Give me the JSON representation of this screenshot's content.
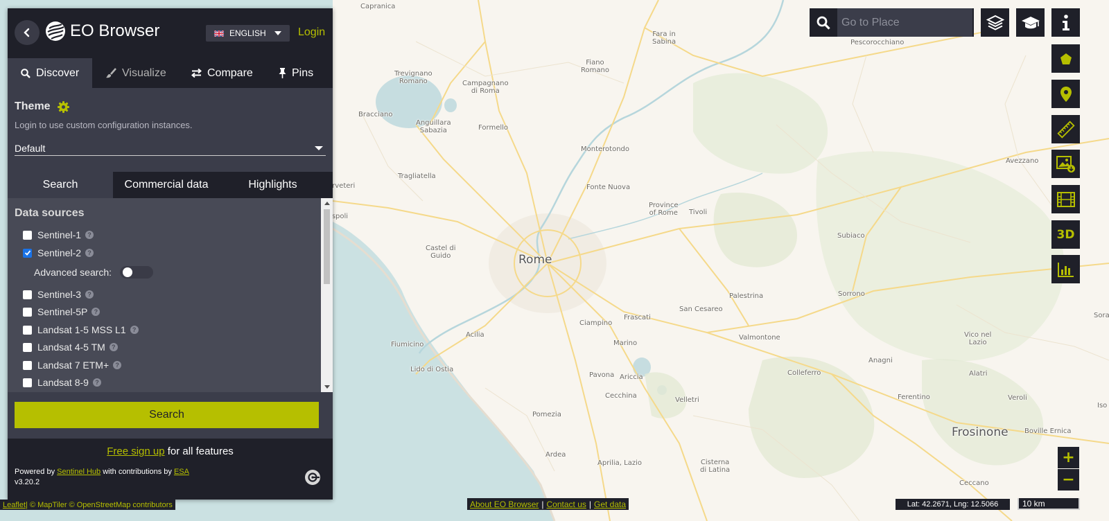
{
  "sidebar": {
    "brand": "EO Browser",
    "language": "ENGLISH",
    "login": "Login",
    "tabs": [
      {
        "label": "Discover"
      },
      {
        "label": "Visualize"
      },
      {
        "label": "Compare"
      },
      {
        "label": "Pins"
      }
    ],
    "theme": {
      "title": "Theme",
      "note": "Login to use custom configuration instances.",
      "selected": "Default"
    },
    "subtabs": [
      {
        "label": "Search"
      },
      {
        "label": "Commercial data"
      },
      {
        "label": "Highlights"
      }
    ],
    "data_sources": {
      "title": "Data sources",
      "items": [
        {
          "label": "Sentinel-1",
          "checked": false
        },
        {
          "label": "Sentinel-2",
          "checked": true
        },
        {
          "label": "Sentinel-3",
          "checked": false
        },
        {
          "label": "Sentinel-5P",
          "checked": false
        },
        {
          "label": "Landsat 1-5 MSS L1",
          "checked": false
        },
        {
          "label": "Landsat 4-5 TM",
          "checked": false
        },
        {
          "label": "Landsat 7 ETM+",
          "checked": false
        },
        {
          "label": "Landsat 8-9",
          "checked": false
        }
      ],
      "advanced_search_label": "Advanced search:",
      "advanced_search_on": false
    },
    "search_button": "Search",
    "footer": {
      "signup_link": "Free sign up",
      "signup_rest": " for all features",
      "powered_by": "Powered by ",
      "sentinel_hub": "Sentinel Hub",
      "contrib": " with contributions by ",
      "esa": "ESA",
      "version": "v3.20.2"
    }
  },
  "place_search": {
    "placeholder": "Go to Place"
  },
  "zoom": {
    "in": "+",
    "out": "−"
  },
  "tools": {
    "three_d": "3D"
  },
  "attribution": {
    "leaflet": "Leaflet",
    "rest": " | © MapTiler © OpenStreetMap contributors"
  },
  "links": {
    "about": "About EO Browser",
    "contact": "Contact us",
    "get_data": "Get data"
  },
  "coords": "Lat: 42.2671, Lng: 12.5066",
  "scale": "10 km",
  "map_labels": [
    {
      "text": "Capranica"
    },
    {
      "text": "Fara in\nSabina"
    },
    {
      "text": "Pescorocchiano"
    },
    {
      "text": "Fiano\nRomano"
    },
    {
      "text": "Trevignano\nRomano"
    },
    {
      "text": "Campagnano\ndi Roma"
    },
    {
      "text": "Bracciano"
    },
    {
      "text": "Anguillara\nSabazia"
    },
    {
      "text": "Formello"
    },
    {
      "text": "Monterotondo"
    },
    {
      "text": "Avezzano"
    },
    {
      "text": "Tragliatella"
    },
    {
      "text": "Fonte Nuova"
    },
    {
      "text": "Cerveteri"
    },
    {
      "text": "Province\nof Rome"
    },
    {
      "text": "Tivoli"
    },
    {
      "text": "Ladispoli"
    },
    {
      "text": "Subiaco"
    },
    {
      "text": "Castel di\nGuido"
    },
    {
      "text": "Rome"
    },
    {
      "text": "Palestrina"
    },
    {
      "text": "Sorrono"
    },
    {
      "text": "San Cesareo"
    },
    {
      "text": "Ciampino"
    },
    {
      "text": "Frascati"
    },
    {
      "text": "Valmontone"
    },
    {
      "text": "Vico nel\nLazio"
    },
    {
      "text": "Fiumicino"
    },
    {
      "text": "Acilia"
    },
    {
      "text": "Marino"
    },
    {
      "text": "Anagni"
    },
    {
      "text": "Lido di Ostia"
    },
    {
      "text": "Colleferro"
    },
    {
      "text": "Pavona"
    },
    {
      "text": "Ariccia"
    },
    {
      "text": "Alatri"
    },
    {
      "text": "Cecchina"
    },
    {
      "text": "Velletri"
    },
    {
      "text": "Ferentino"
    },
    {
      "text": "Veroli"
    },
    {
      "text": "Pomezia"
    },
    {
      "text": "Frosinone"
    },
    {
      "text": "Boville Ernica"
    },
    {
      "text": "Ardea"
    },
    {
      "text": "Aprilia, Lazio"
    },
    {
      "text": "Cisterna\ndi Latina"
    },
    {
      "text": "Ceccano"
    },
    {
      "text": "Sora"
    },
    {
      "text": "Iso"
    }
  ]
}
